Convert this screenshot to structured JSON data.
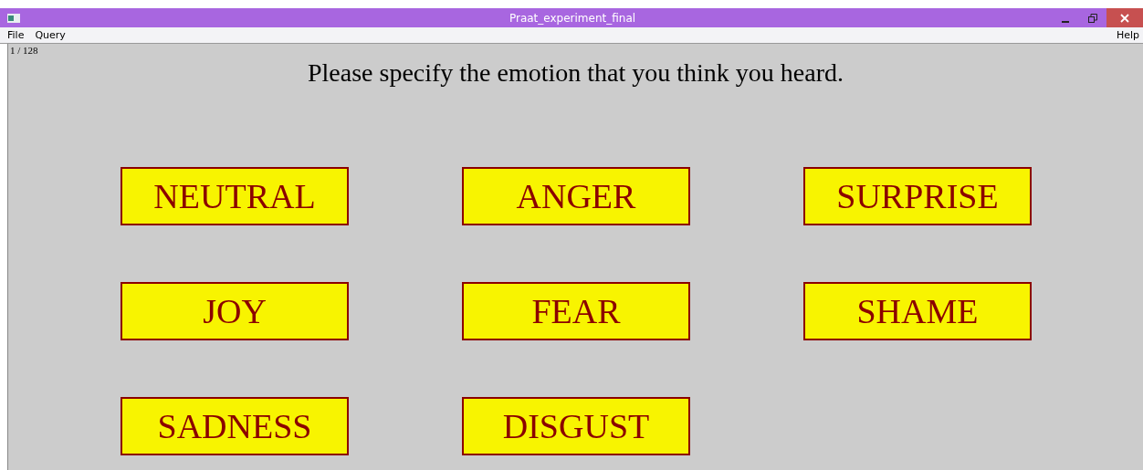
{
  "window": {
    "title": "Praat_experiment_final"
  },
  "menu": {
    "left": [
      "File",
      "Query"
    ],
    "right": [
      "Help"
    ]
  },
  "progress": "1 / 128",
  "prompt": "Please specify the emotion that you think you heard.",
  "choices": [
    {
      "label": "NEUTRAL"
    },
    {
      "label": "ANGER"
    },
    {
      "label": "SURPRISE"
    },
    {
      "label": "JOY"
    },
    {
      "label": "FEAR"
    },
    {
      "label": "SHAME"
    },
    {
      "label": "SADNESS"
    },
    {
      "label": "DISGUST"
    }
  ]
}
